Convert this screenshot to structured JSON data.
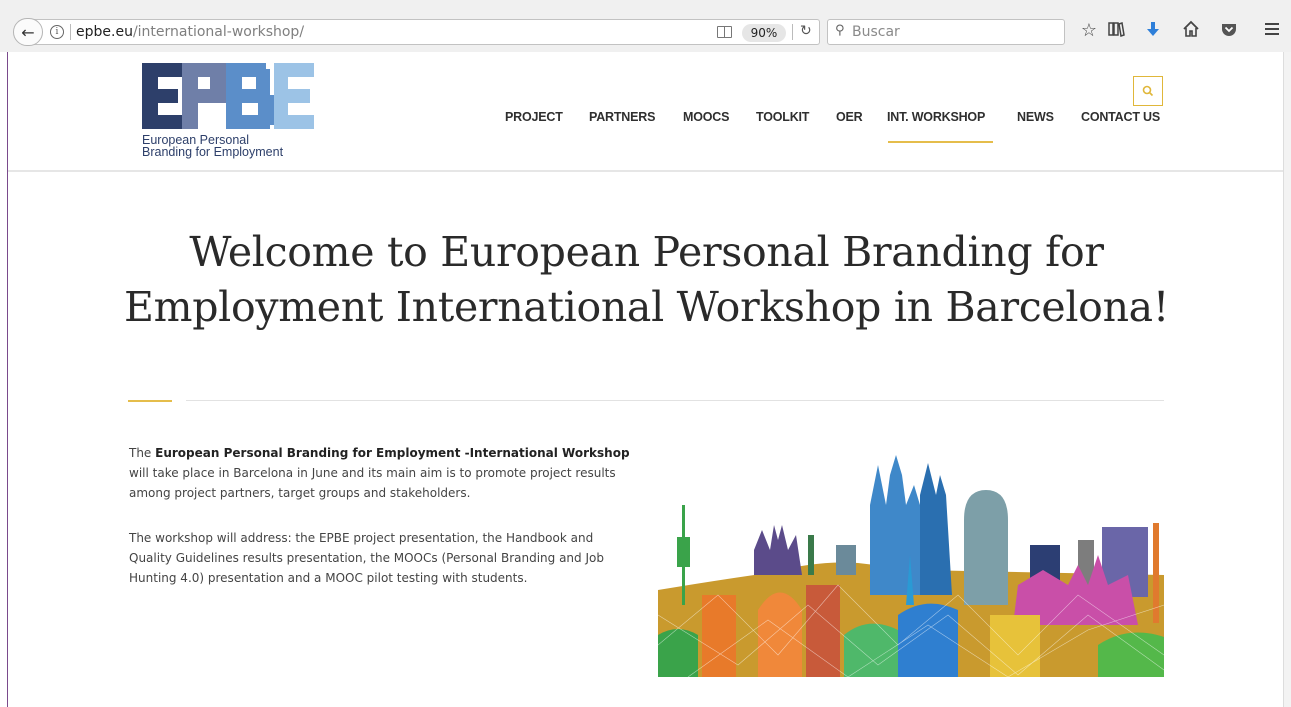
{
  "browser": {
    "url_domain": "epbe.eu",
    "url_path": "/international-workshop/",
    "zoom": "90%",
    "search_placeholder": "Buscar"
  },
  "logo": {
    "caption_line1": "European Personal",
    "caption_line2": "Branding for Employment"
  },
  "nav": {
    "items": [
      "PROJECT",
      "PARTNERS",
      "MOOCS",
      "TOOLKIT",
      "OER",
      "INT. WORKSHOP",
      "NEWS",
      "CONTACT US"
    ],
    "active": "INT. WORKSHOP"
  },
  "main": {
    "title": "Welcome to European Personal Branding for Employment International Workshop in Barcelona!",
    "p1_prefix": "The ",
    "p1_bold": "European Personal Branding for Employment -International Workshop",
    "p1_rest": " will take place in Barcelona in June and its main aim is to promote project results among project partners, target groups and stakeholders.",
    "p2": "The workshop will address: the EPBE project presentation, the Handbook and Quality Guidelines results presentation, the MOOCs (Personal Branding and Job Hunting 4.0) presentation and a MOOC pilot testing with students."
  },
  "colors": {
    "accent": "#e5bd4b",
    "logo_dark": "#2d3f6a",
    "logo_mid": "#5b7fb8",
    "logo_light": "#8fb8e0"
  }
}
